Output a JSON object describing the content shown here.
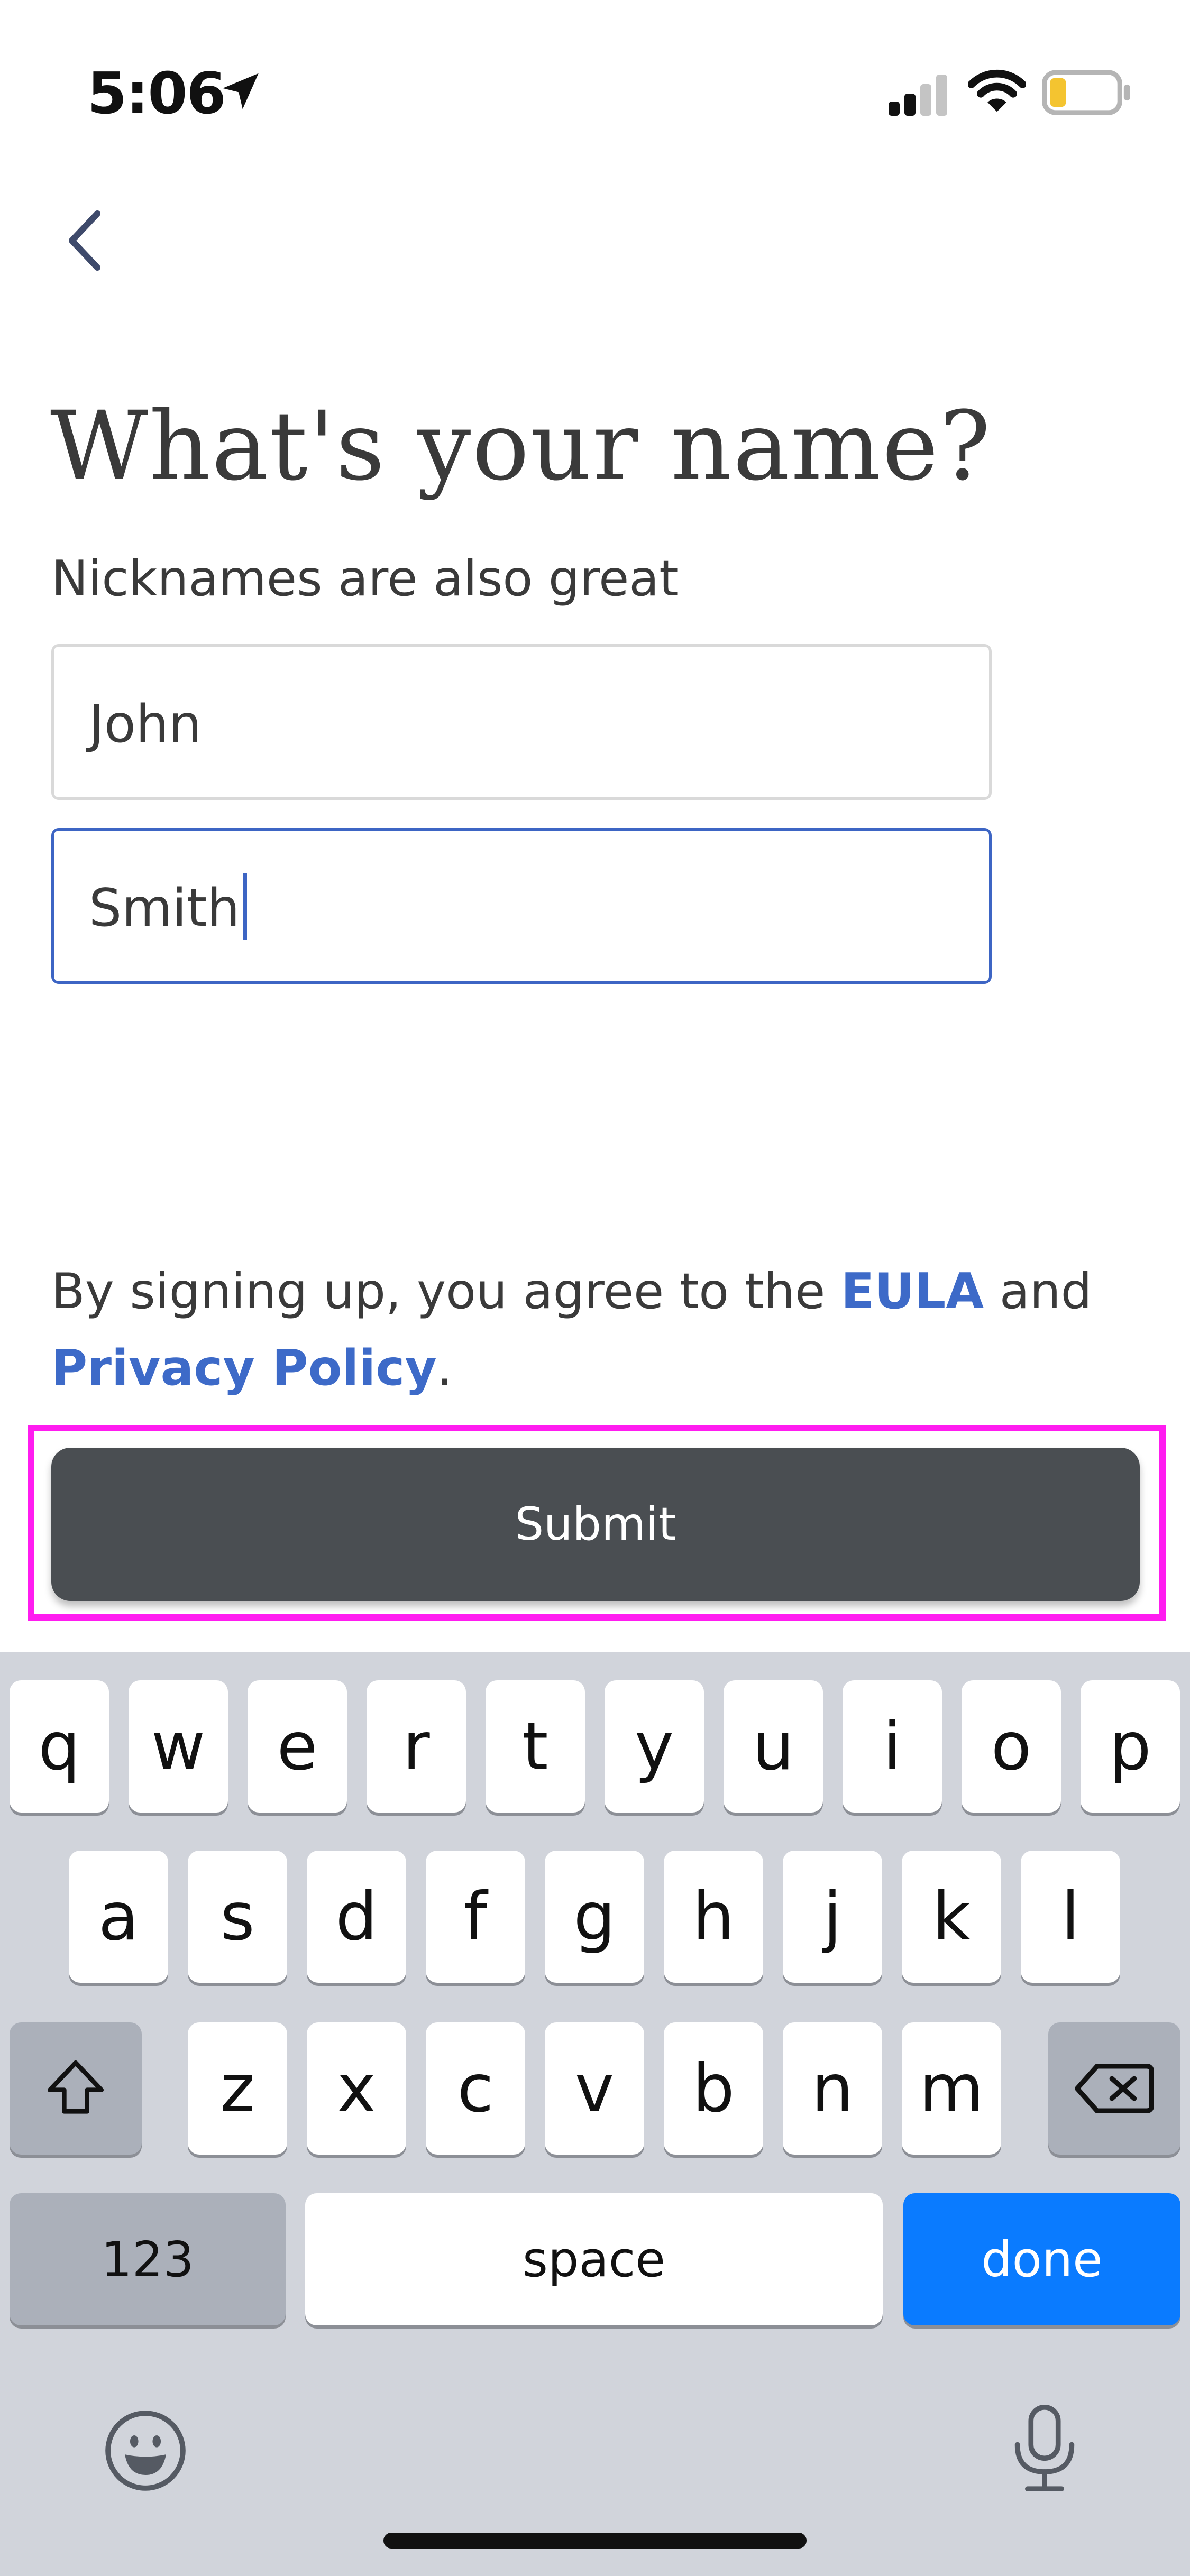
{
  "status_bar": {
    "time": "5:06"
  },
  "heading": {
    "title": "What's your name?",
    "subtitle": "Nicknames are also great"
  },
  "form": {
    "first_name_value": "John",
    "last_name_value": "Smith"
  },
  "legal": {
    "prefix": "By signing up, you agree to the ",
    "eula": "EULA",
    "middle": " and",
    "privacy": "Privacy Policy",
    "suffix": "."
  },
  "submit": {
    "label": "Submit"
  },
  "keyboard": {
    "row1": [
      "q",
      "w",
      "e",
      "r",
      "t",
      "y",
      "u",
      "i",
      "o",
      "p"
    ],
    "row2": [
      "a",
      "s",
      "d",
      "f",
      "g",
      "h",
      "j",
      "k",
      "l"
    ],
    "row3": [
      "z",
      "x",
      "c",
      "v",
      "b",
      "n",
      "m"
    ],
    "numbers_label": "123",
    "space_label": "space",
    "done_label": "done"
  },
  "colors": {
    "accent": "#3d65c4",
    "highlight": "#ff1cf0",
    "button": "#4a4e52",
    "done": "#0a7bff"
  }
}
